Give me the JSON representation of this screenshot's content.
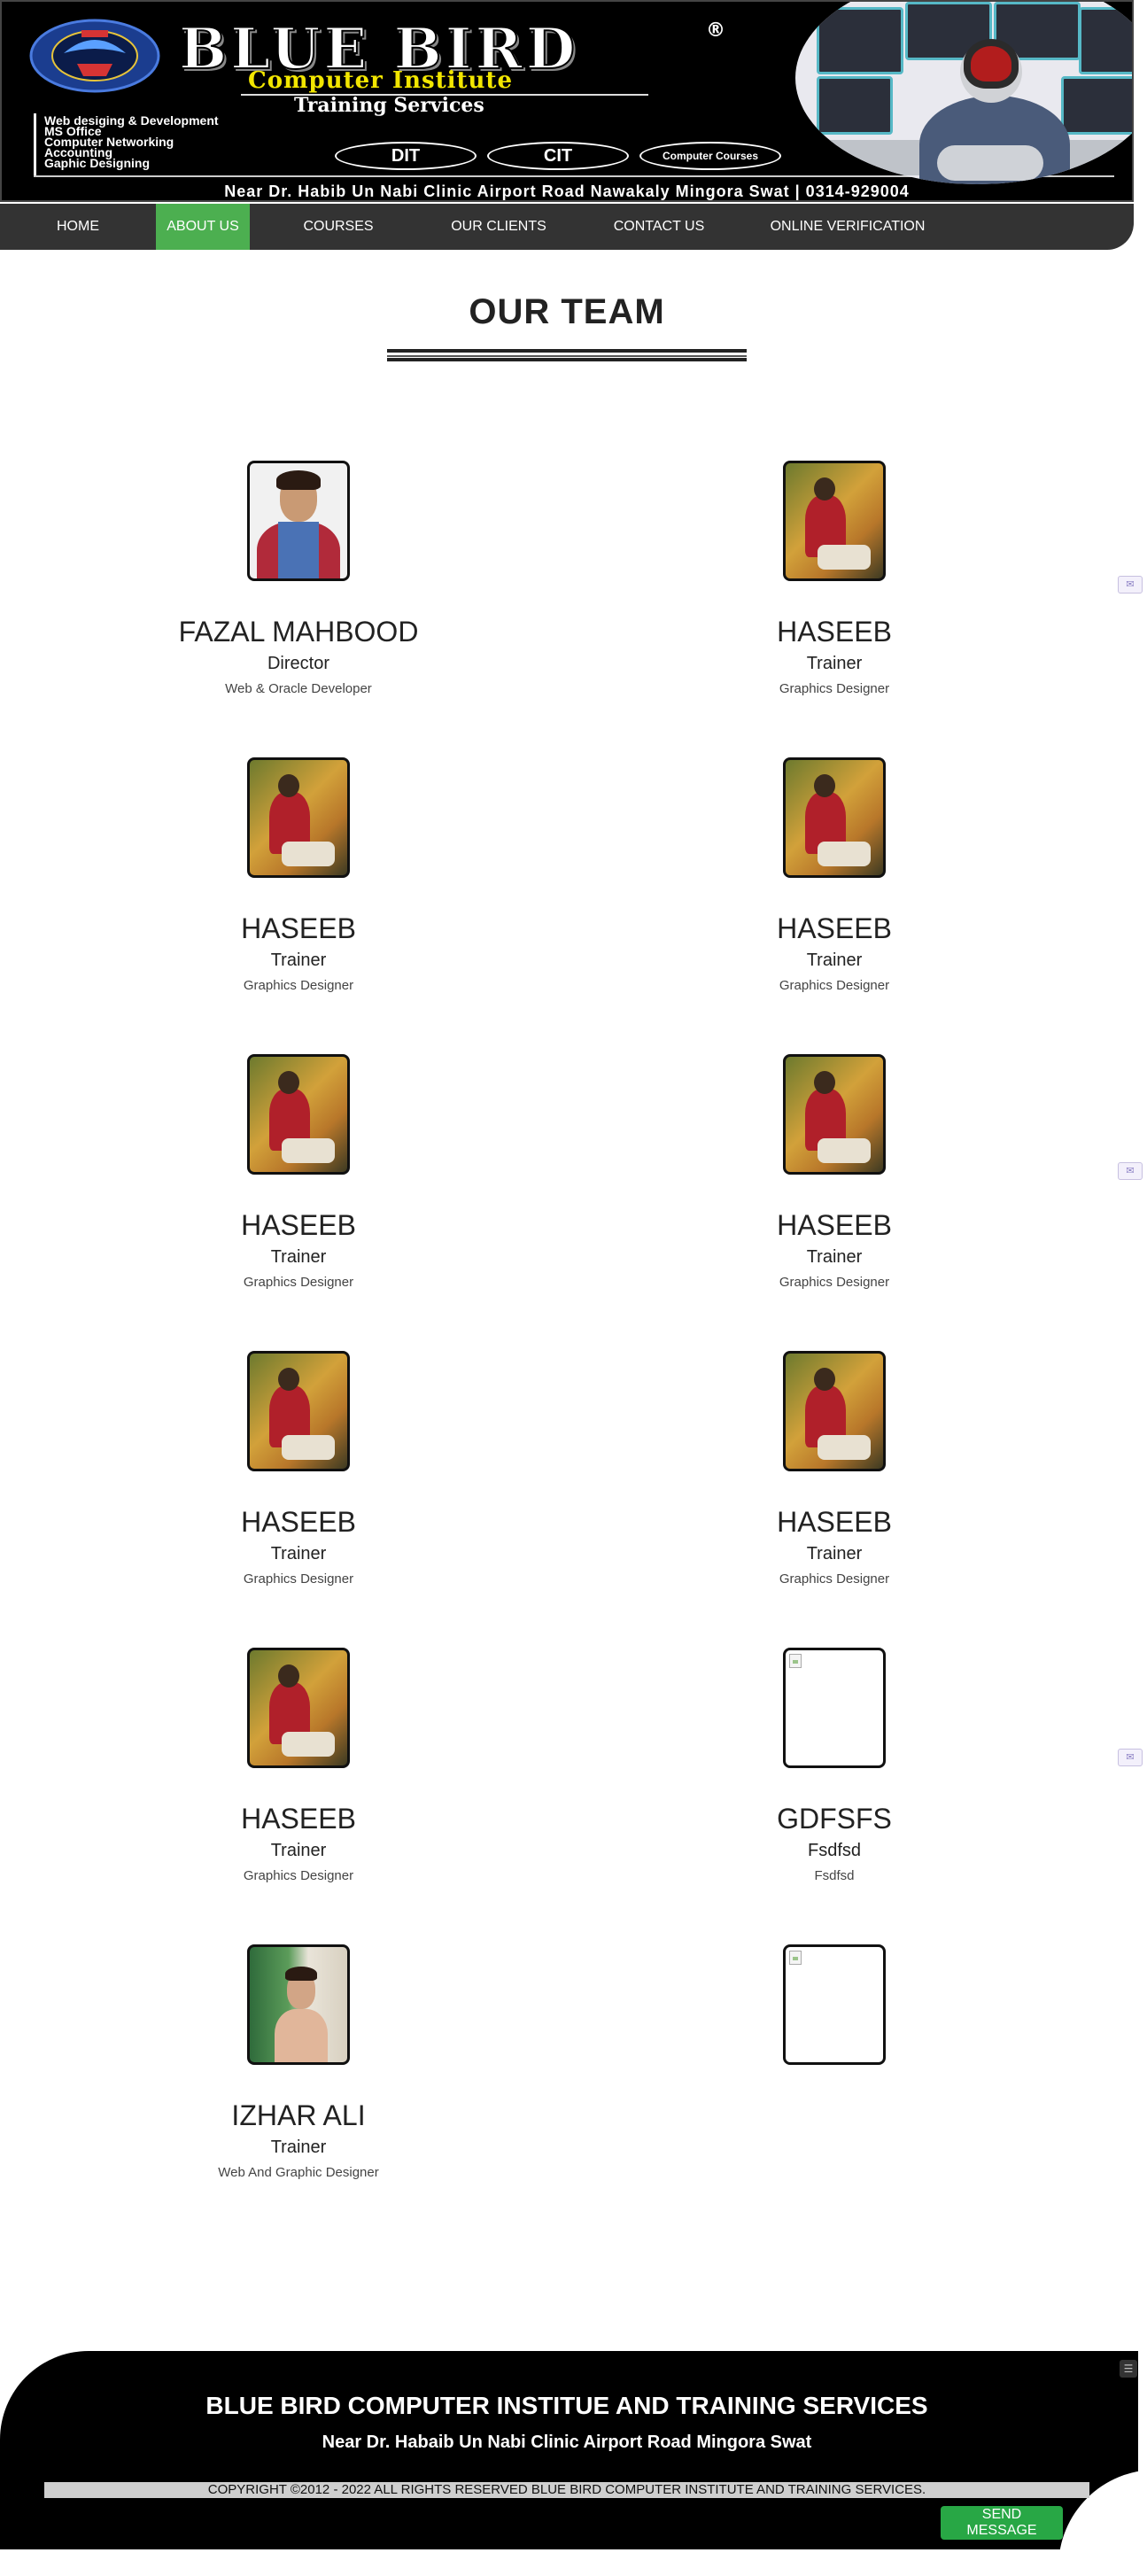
{
  "banner": {
    "brand_name": "BLUE BIRD",
    "registered_mark": "®",
    "subtitle": "Computer Institute",
    "tagline": "Training Services",
    "services": [
      "Web desiging & Development",
      "MS Office",
      "Computer Networking",
      "Accounting",
      "Gaphic Designing"
    ],
    "programs": [
      "DIT",
      "CIT",
      "Computer Courses"
    ],
    "address_line": "Near Dr. Habib Un Nabi Clinic Airport Road Nawakaly Mingora Swat | 0314-929004"
  },
  "nav": {
    "items": [
      {
        "label": "HOME",
        "active": false
      },
      {
        "label": "ABOUT US",
        "active": true
      },
      {
        "label": "COURSES",
        "active": false
      },
      {
        "label": "OUR CLIENTS",
        "active": false
      },
      {
        "label": "CONTACT US",
        "active": false
      },
      {
        "label": "ONLINE VERIFICATION",
        "active": false
      }
    ]
  },
  "page": {
    "title": "OUR TEAM"
  },
  "team": [
    {
      "name": "FAZAL MAHBOOD",
      "role": "Director",
      "description": "Web & Oracle Developer",
      "photo": "director"
    },
    {
      "name": "HASEEB",
      "role": "Trainer",
      "description": "Graphics Designer",
      "photo": "trainer-a"
    },
    {
      "name": "HASEEB",
      "role": "Trainer",
      "description": "Graphics Designer",
      "photo": "trainer-a"
    },
    {
      "name": "HASEEB",
      "role": "Trainer",
      "description": "Graphics Designer",
      "photo": "trainer-a"
    },
    {
      "name": "HASEEB",
      "role": "Trainer",
      "description": "Graphics Designer",
      "photo": "trainer-a"
    },
    {
      "name": "HASEEB",
      "role": "Trainer",
      "description": "Graphics Designer",
      "photo": "trainer-a"
    },
    {
      "name": "HASEEB",
      "role": "Trainer",
      "description": "Graphics Designer",
      "photo": "trainer-a"
    },
    {
      "name": "HASEEB",
      "role": "Trainer",
      "description": "Graphics Designer",
      "photo": "trainer-a"
    },
    {
      "name": "HASEEB",
      "role": "Trainer",
      "description": "Graphics Designer",
      "photo": "trainer-a"
    },
    {
      "name": "GDFSFS",
      "role": "Fsdfsd",
      "description": "Fsdfsd",
      "photo": "broken"
    },
    {
      "name": "IZHAR ALI",
      "role": "Trainer",
      "description": "Web And Graphic Designer",
      "photo": "izhar"
    },
    {
      "name": "",
      "role": "",
      "description": "",
      "photo": "broken"
    }
  ],
  "footer": {
    "title": "BLUE BIRD COMPUTER INSTITUE AND TRAINING SERVICES",
    "address": "Near Dr. Habaib Un Nabi Clinic Airport Road Mingora Swat",
    "copyright": "COPYRIGHT ©2012 - 2022 ALL RIGHTS RESERVED BLUE BIRD COMPUTER INSTITUTE AND TRAINING SERVICES.",
    "send_button": "SEND MESSAGE"
  },
  "icons": {
    "side_widget": "mail-icon",
    "chat": "chat-icon"
  },
  "colors": {
    "nav_active": "#4caf50",
    "nav_bg": "#333333",
    "send_button": "#28a745",
    "banner_accent": "#f2e600"
  }
}
